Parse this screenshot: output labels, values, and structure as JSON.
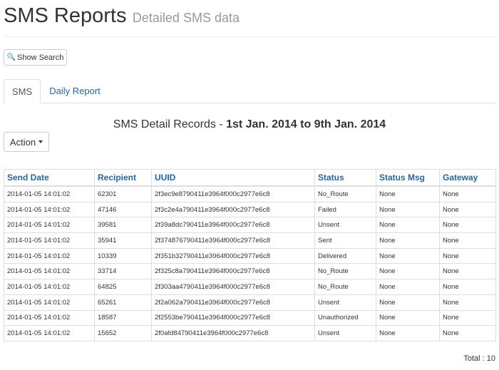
{
  "header": {
    "title": "SMS Reports",
    "subtitle": "Detailed SMS data"
  },
  "toolbar": {
    "show_search_label": "Show Search",
    "action_label": "Action"
  },
  "tabs": [
    {
      "label": "SMS",
      "active": true
    },
    {
      "label": "Daily Report",
      "active": false
    }
  ],
  "records": {
    "title_prefix": "SMS Detail Records - ",
    "date_range": "1st Jan. 2014 to 9th Jan. 2014"
  },
  "table": {
    "columns": [
      "Send Date",
      "Recipient",
      "UUID",
      "Status",
      "Status Msg",
      "Gateway"
    ],
    "rows": [
      [
        "2014-01-05 14:01:02",
        "62301",
        "2f3ec9e8790411e3964f000c2977e6c8",
        "No_Route",
        "None",
        "None"
      ],
      [
        "2014-01-05 14:01:02",
        "47146",
        "2f3c2e4a790411e3964f000c2977e6c8",
        "Failed",
        "None",
        "None"
      ],
      [
        "2014-01-05 14:01:02",
        "39581",
        "2f39a8dc790411e3964f000c2977e6c8",
        "Unsent",
        "None",
        "None"
      ],
      [
        "2014-01-05 14:01:02",
        "35941",
        "2f374876790411e3964f000c2977e6c8",
        "Sent",
        "None",
        "None"
      ],
      [
        "2014-01-05 14:01:02",
        "10339",
        "2f351b32790411e3964f000c2977e6c8",
        "Delivered",
        "None",
        "None"
      ],
      [
        "2014-01-05 14:01:02",
        "33714",
        "2f325c8a790411e3964f000c2977e6c8",
        "No_Route",
        "None",
        "None"
      ],
      [
        "2014-01-05 14:01:02",
        "64825",
        "2f303aa4790411e3964f000c2977e6c8",
        "No_Route",
        "None",
        "None"
      ],
      [
        "2014-01-05 14:01:02",
        "65261",
        "2f2a062a790411e3964f000c2977e6c8",
        "Unsent",
        "None",
        "None"
      ],
      [
        "2014-01-05 14:01:02",
        "18587",
        "2f2553be790411e3964f000c2977e6c8",
        "Unauthorized",
        "None",
        "None"
      ],
      [
        "2014-01-05 14:01:02",
        "15652",
        "2f0afd84790411e3964f000c2977e6c8",
        "Unsent",
        "None",
        "None"
      ]
    ]
  },
  "footer": {
    "total_label": "Total : 10"
  },
  "colors": {
    "link": "#2a6496",
    "muted": "#999999",
    "border": "#dddddd"
  }
}
